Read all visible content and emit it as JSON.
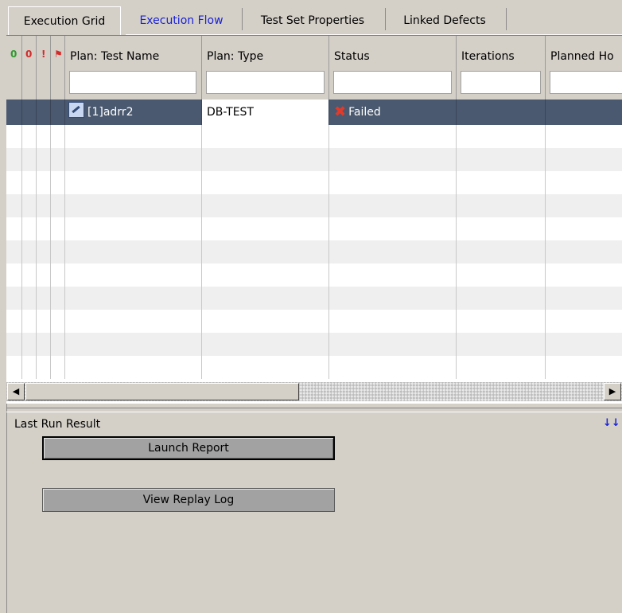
{
  "tabs": [
    {
      "label": "Execution Grid",
      "active": true
    },
    {
      "label": "Execution Flow",
      "active": false
    },
    {
      "label": "Test Set Properties",
      "active": false
    },
    {
      "label": "Linked Defects",
      "active": false
    }
  ],
  "grid": {
    "icon_columns": [
      "attachment-icon",
      "attachment-red-icon",
      "exclamation-icon",
      "flag-icon"
    ],
    "columns": [
      "Plan: Test Name",
      "Plan: Type",
      "Status",
      "Iterations",
      "Planned Ho"
    ],
    "rows": [
      {
        "test_name": "[1]adrr2",
        "type": "DB-TEST",
        "status": "Failed",
        "iterations": "",
        "planned_host": ""
      }
    ]
  },
  "bottom_panel": {
    "title": "Last Run Result",
    "launch_report": "Launch Report",
    "view_replay_log": "View Replay Log"
  },
  "colors": {
    "selection": "#4a596f",
    "link_blue": "#1a22d6",
    "failed_red": "#e23a2a"
  }
}
